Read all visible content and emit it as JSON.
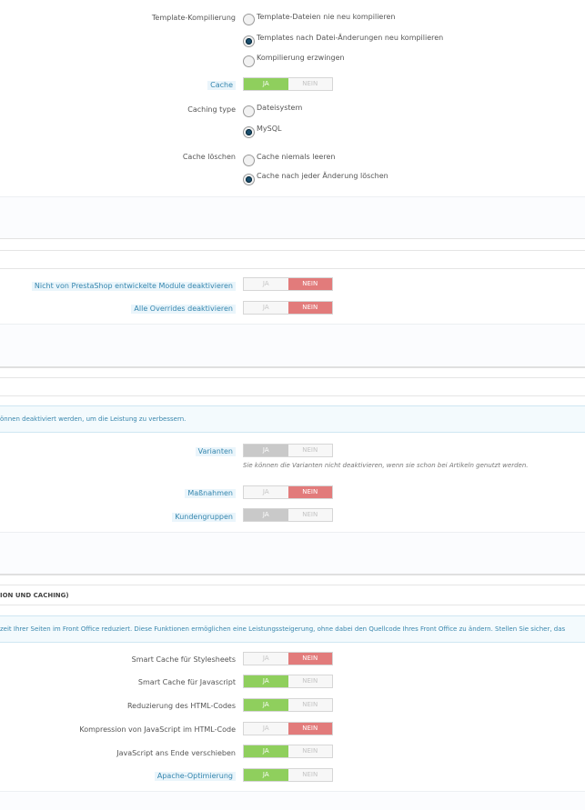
{
  "template": {
    "label": "Template-Kompilierung",
    "options": [
      {
        "text": "Template-Dateien nie neu kompilieren",
        "selected": false
      },
      {
        "text": "Templates nach Datei-Änderungen neu kompilieren",
        "selected": true
      },
      {
        "text": "Kompilierung erzwingen",
        "selected": false
      }
    ]
  },
  "cache": {
    "label": "Cache",
    "yes": "JA",
    "no": "NEIN",
    "value": "JA"
  },
  "caching_type": {
    "label": "Caching type",
    "options": [
      {
        "text": "Dateisystem",
        "selected": false
      },
      {
        "text": "MySQL",
        "selected": true
      }
    ]
  },
  "cache_clear": {
    "label": "Cache löschen",
    "options": [
      {
        "text": "Cache niemals leeren",
        "selected": false
      },
      {
        "text": "Cache nach jeder Änderung löschen",
        "selected": true
      }
    ]
  },
  "debug": {
    "modules": {
      "label": "Nicht von PrestaShop entwickelte Module deaktivieren",
      "yes": "JA",
      "no": "NEIN",
      "value": "NEIN"
    },
    "overrides": {
      "label": "Alle Overrides deaktivieren",
      "yes": "JA",
      "no": "NEIN",
      "value": "NEIN"
    }
  },
  "features": {
    "alert": "önnen deaktiviert werden, um die Leistung zu verbessern.",
    "variants": {
      "label": "Varianten",
      "yes": "JA",
      "no": "NEIN",
      "value": "JA"
    },
    "variants_note": "Sie können die Varianten nicht deaktivieren, wenn sie schon bei Artikeln genutzt werden.",
    "measures": {
      "label": "Maßnahmen",
      "yes": "JA",
      "no": "NEIN",
      "value": "NEIN"
    },
    "groups": {
      "label": "Kundengruppen",
      "yes": "JA",
      "no": "NEIN",
      "value": "JA"
    }
  },
  "ccc": {
    "heading": "ION UND CACHING)",
    "alert": "zeit Ihrer Seiten im Front Office reduziert. Diese Funktionen ermöglichen eine Leistungssteigerung, ohne dabei den Quellcode Ihres Front Office zu ändern. Stellen Sie sicher, das",
    "css": {
      "label": "Smart Cache für Stylesheets",
      "yes": "JA",
      "no": "NEIN",
      "value": "NEIN"
    },
    "js": {
      "label": "Smart Cache für Javascript",
      "yes": "JA",
      "no": "NEIN",
      "value": "JA"
    },
    "html": {
      "label": "Reduzierung des HTML-Codes",
      "yes": "JA",
      "no": "NEIN",
      "value": "JA"
    },
    "jscomp": {
      "label": "Kompression von JavaScript im HTML-Code",
      "yes": "JA",
      "no": "NEIN",
      "value": "NEIN"
    },
    "jsend": {
      "label": "JavaScript ans Ende verschieben",
      "yes": "JA",
      "no": "NEIN",
      "value": "JA"
    },
    "apache": {
      "label": "Apache-Optimierung",
      "yes": "JA",
      "no": "NEIN",
      "value": "JA"
    }
  }
}
